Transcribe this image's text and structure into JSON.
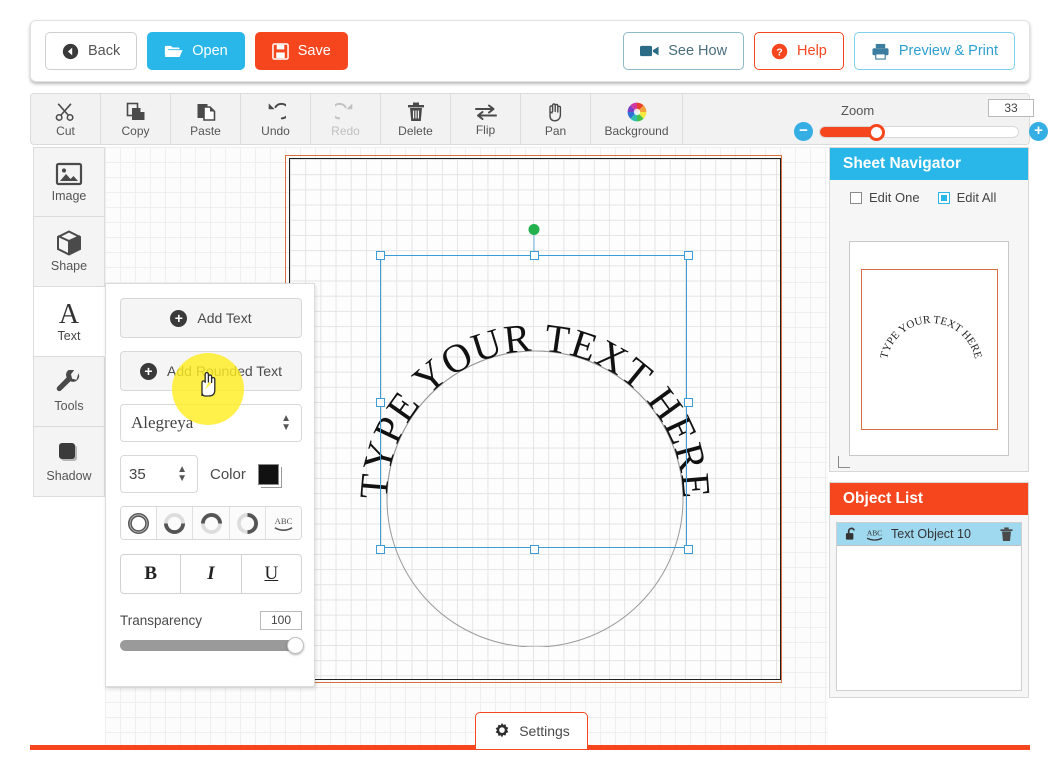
{
  "topbar": {
    "back": "Back",
    "open": "Open",
    "save": "Save",
    "see_how": "See How",
    "help": "Help",
    "preview_print": "Preview & Print",
    "icons": {
      "back": "back-arrow-circle-icon",
      "open": "folder-open-icon",
      "save": "floppy-disk-icon",
      "see_how": "video-camera-icon",
      "help": "question-mark-circle-icon",
      "preview_print": "printer-icon"
    }
  },
  "toolstrip": {
    "items": [
      {
        "label": "Cut",
        "icon": "scissors-icon",
        "disabled": false
      },
      {
        "label": "Copy",
        "icon": "copy-pages-icon",
        "disabled": false
      },
      {
        "label": "Paste",
        "icon": "clipboard-icon",
        "disabled": false
      },
      {
        "label": "Undo",
        "icon": "undo-arrow-icon",
        "disabled": false
      },
      {
        "label": "Redo",
        "icon": "redo-arrow-icon",
        "disabled": true
      },
      {
        "label": "Delete",
        "icon": "trash-can-icon",
        "disabled": false
      },
      {
        "label": "Flip",
        "icon": "flip-arrows-icon",
        "disabled": false
      },
      {
        "label": "Pan",
        "icon": "hand-icon",
        "disabled": false
      },
      {
        "label": "Background",
        "icon": "color-wheel-icon",
        "disabled": false
      }
    ],
    "zoom": {
      "label": "Zoom",
      "value": "33",
      "minus_icon": "minus-circle-icon",
      "plus_icon": "plus-circle-icon"
    }
  },
  "rail": {
    "items": [
      {
        "label": "Image",
        "icon": "picture-icon",
        "active": false
      },
      {
        "label": "Shape",
        "icon": "cube-icon",
        "active": false
      },
      {
        "label": "Text",
        "icon": "letter-a-icon",
        "active": true
      },
      {
        "label": "Tools",
        "icon": "wrench-icon",
        "active": false
      },
      {
        "label": "Shadow",
        "icon": "square-shadow-icon",
        "active": false
      }
    ]
  },
  "text_panel": {
    "add_text": "Add Text",
    "add_rounded_text": "Add Rounded Text",
    "font": "Alegreya",
    "font_size": "35",
    "color_label": "Color",
    "color_value": "#111111",
    "curve_buttons": [
      {
        "name": "curve-full-circle",
        "active": true
      },
      {
        "name": "curve-bottom-half",
        "active": false
      },
      {
        "name": "curve-top-half",
        "active": false
      },
      {
        "name": "curve-right-half",
        "active": false
      },
      {
        "name": "curve-arc-abc",
        "active": false
      }
    ],
    "style_buttons": [
      {
        "label": "B",
        "name": "bold-button"
      },
      {
        "label": "I",
        "name": "italic-button"
      },
      {
        "label": "U",
        "name": "underline-button"
      }
    ],
    "transparency_label": "Transparency",
    "transparency_value": "100"
  },
  "canvas": {
    "arc_text": "TYPE YOUR TEXT HERE",
    "settings_label": "Settings",
    "settings_icon": "gear-icon",
    "sheet_border_color": "#d8703f",
    "selection_color": "#3d9bd6",
    "rotation_handle_color": "#22b14c"
  },
  "sheet_navigator": {
    "title": "Sheet Navigator",
    "edit_one": "Edit One",
    "edit_all": "Edit All",
    "edit_one_checked": false,
    "edit_all_checked": true,
    "thumbnail_text": "TYPE YOUR TEXT HERE"
  },
  "object_list": {
    "title": "Object List",
    "rows": [
      {
        "name": "Text Object 10",
        "lock_icon": "unlocked-padlock-icon",
        "type_icon": "abc-curved-text-icon",
        "delete_icon": "trash-can-icon"
      }
    ]
  },
  "theme": {
    "blue": "#29b6e8",
    "orange": "#f5461e",
    "panel_grey": "#f2f2f2"
  }
}
